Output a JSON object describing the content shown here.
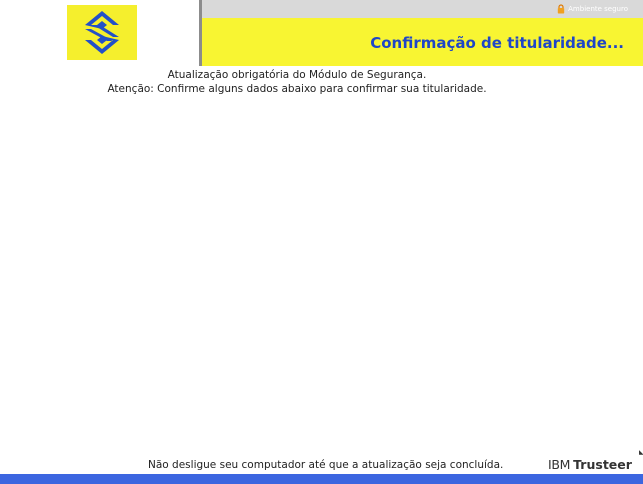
{
  "header": {
    "logo_name": "banco-do-brasil-logo",
    "secure_label": "Ambiente seguro",
    "title": "Confirmação de titularidade..."
  },
  "main": {
    "message_1": "Atualização obrigatória do Módulo de Segurança.",
    "message_2": "Atenção: Confirme alguns dados abaixo para confirmar sua titularidade."
  },
  "footer": {
    "notice": "Não desligue seu computador até que a atualização seja concluída.",
    "brand_prefix": "IBM",
    "brand_name": "Trusteer"
  },
  "colors": {
    "brand_yellow": "#f8f532",
    "title_blue": "#1f46c8",
    "bottom_bar_blue": "#3c66e0",
    "secure_bar_gray": "#d9d9d9"
  }
}
